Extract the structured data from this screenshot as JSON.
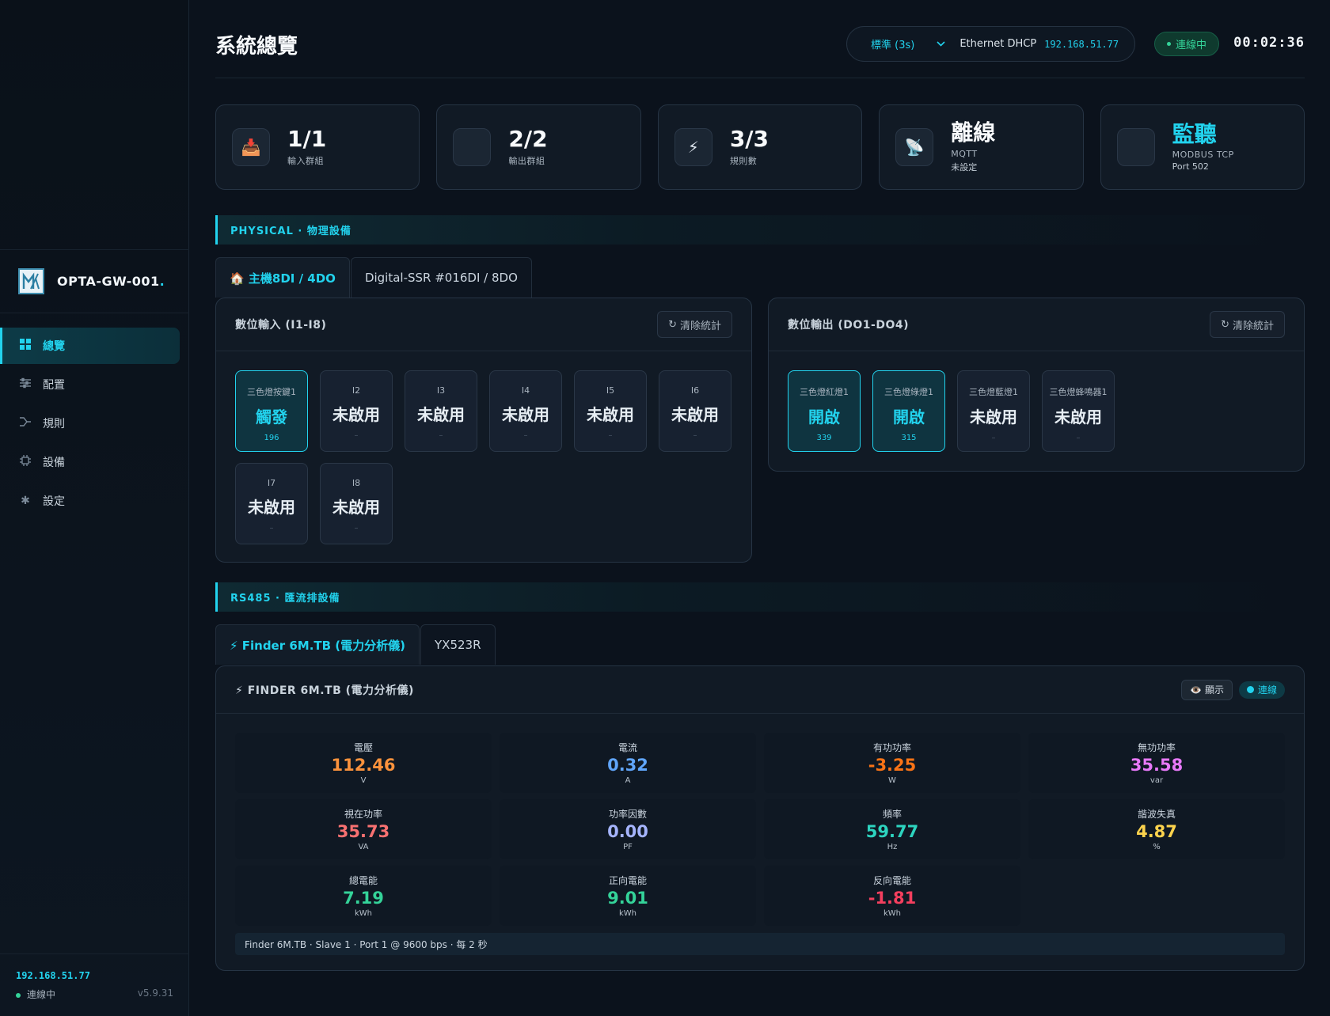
{
  "sidebar": {
    "brand": "OPTA-GW-001",
    "brand_dot": ".",
    "items": [
      {
        "label": "總覽",
        "icon": "grid-icon"
      },
      {
        "label": "配置",
        "icon": "sliders-icon"
      },
      {
        "label": "規則",
        "icon": "branch-icon"
      },
      {
        "label": "設備",
        "icon": "chip-icon"
      },
      {
        "label": "設定",
        "icon": "gear-icon"
      }
    ],
    "footer_ip": "192.168.51.77",
    "footer_status": "連線中",
    "version": "v5.9.31"
  },
  "header": {
    "title": "系統總覽",
    "refresh_select": "標準 (3s)",
    "network_label": "Ethernet DHCP",
    "network_ip": "192.168.51.77",
    "status": "連線中",
    "clock": "00:02:36"
  },
  "stats": [
    {
      "value": "1/1",
      "label": "輸入群組",
      "sub": "",
      "icon": "📥"
    },
    {
      "value": "2/2",
      "label": "輸出群組",
      "sub": "",
      "icon": ""
    },
    {
      "value": "3/3",
      "label": "規則數",
      "sub": "",
      "icon": "⚡"
    },
    {
      "value": "離線",
      "label": "MQTT",
      "sub": "未設定",
      "icon": "📡"
    },
    {
      "value": "監聽",
      "label": "MODBUS TCP",
      "sub": "Port 502",
      "icon": ""
    }
  ],
  "physical": {
    "banner": "PHYSICAL · 物理設備",
    "tabs": [
      "🏠 主機8DI / 4DO",
      "Digital-SSR #016DI / 8DO"
    ],
    "inputs": {
      "title": "數位輸入 (I1-I8)",
      "clear_label": "清除統計",
      "items": [
        {
          "label": "三色燈按鍵1",
          "state": "觸發",
          "count": "196",
          "on": true
        },
        {
          "label": "I2",
          "state": "未啟用",
          "count": "–",
          "on": false
        },
        {
          "label": "I3",
          "state": "未啟用",
          "count": "–",
          "on": false
        },
        {
          "label": "I4",
          "state": "未啟用",
          "count": "–",
          "on": false
        },
        {
          "label": "I5",
          "state": "未啟用",
          "count": "–",
          "on": false
        },
        {
          "label": "I6",
          "state": "未啟用",
          "count": "–",
          "on": false
        },
        {
          "label": "I7",
          "state": "未啟用",
          "count": "–",
          "on": false
        },
        {
          "label": "I8",
          "state": "未啟用",
          "count": "–",
          "on": false
        }
      ]
    },
    "outputs": {
      "title": "數位輸出 (DO1-DO4)",
      "clear_label": "清除統計",
      "items": [
        {
          "label": "三色燈紅燈1",
          "state": "開啟",
          "count": "339",
          "on": true
        },
        {
          "label": "三色燈綠燈1",
          "state": "開啟",
          "count": "315",
          "on": true
        },
        {
          "label": "三色燈藍燈1",
          "state": "未啟用",
          "count": "–",
          "on": false
        },
        {
          "label": "三色燈蜂鳴器1",
          "state": "未啟用",
          "count": "–",
          "on": false
        }
      ]
    }
  },
  "rs485": {
    "banner": "RS485 · 匯流排設備",
    "tabs": [
      "⚡ Finder 6M.TB (電力分析儀)",
      "YX523R"
    ],
    "panel_title": "⚡ FINDER 6M.TB (電力分析儀)",
    "show_label": "👁️ 顯示",
    "link_label": "連線",
    "metrics": [
      {
        "name": "電壓",
        "value": "112.46",
        "unit": "V",
        "color": "#fb923c"
      },
      {
        "name": "電流",
        "value": "0.32",
        "unit": "A",
        "color": "#60a5fa"
      },
      {
        "name": "有功功率",
        "value": "-3.25",
        "unit": "W",
        "color": "#f97316"
      },
      {
        "name": "無功功率",
        "value": "35.58",
        "unit": "var",
        "color": "#e879f9"
      },
      {
        "name": "視在功率",
        "value": "35.73",
        "unit": "VA",
        "color": "#f87171"
      },
      {
        "name": "功率因數",
        "value": "0.00",
        "unit": "PF",
        "color": "#a5b4fc"
      },
      {
        "name": "頻率",
        "value": "59.77",
        "unit": "Hz",
        "color": "#2dd4bf"
      },
      {
        "name": "諧波失真",
        "value": "4.87",
        "unit": "%",
        "color": "#fcd34d"
      },
      {
        "name": "總電能",
        "value": "7.19",
        "unit": "kWh",
        "color": "#34d399"
      },
      {
        "name": "正向電能",
        "value": "9.01",
        "unit": "kWh",
        "color": "#34d399"
      },
      {
        "name": "反向電能",
        "value": "-1.81",
        "unit": "kWh",
        "color": "#f43f5e"
      }
    ],
    "footer": "Finder 6M.TB · Slave 1 · Port 1 @ 9600 bps · 每 2 秒"
  }
}
